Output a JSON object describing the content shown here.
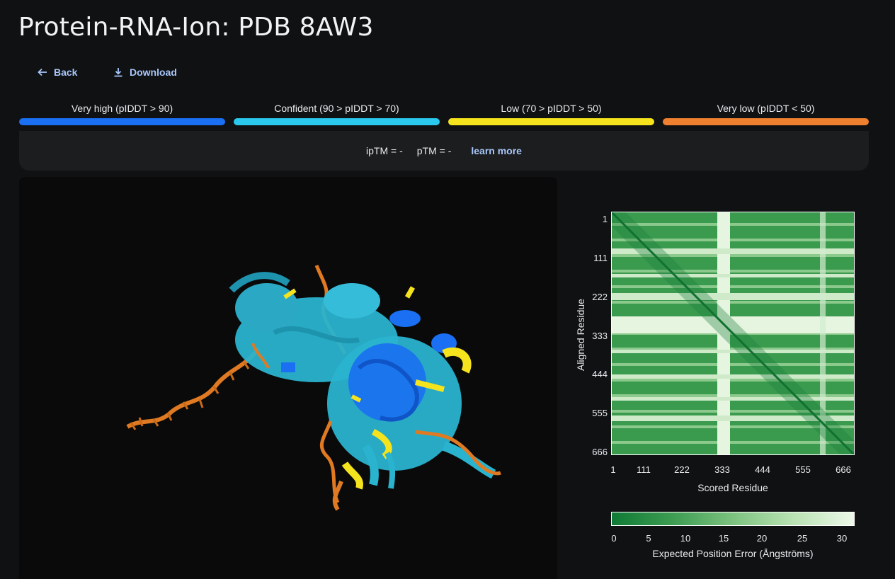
{
  "header": {
    "title": "Protein-RNA-Ion: PDB 8AW3"
  },
  "actions": {
    "back_label": "Back",
    "download_label": "Download"
  },
  "plddt_legend": [
    {
      "label": "Very high (pIDDT > 90)",
      "color": "#1a6ff2"
    },
    {
      "label": "Confident (90 > pIDDT > 70)",
      "color": "#29c8ec"
    },
    {
      "label": "Low (70 > pIDDT > 50)",
      "color": "#f5e41d"
    },
    {
      "label": "Very low (pIDDT < 50)",
      "color": "#ee8030"
    }
  ],
  "scores": {
    "iptm": "ipTM = -",
    "ptm": "pTM = -",
    "learn_more": "learn more"
  },
  "pae": {
    "y_ticks": [
      "1",
      "111",
      "222",
      "333",
      "444",
      "555",
      "666"
    ],
    "x_ticks": [
      "1",
      "111",
      "222",
      "333",
      "444",
      "555",
      "666"
    ],
    "y_label": "Aligned Residue",
    "x_label": "Scored Residue",
    "colorbar_ticks": [
      "0",
      "5",
      "10",
      "15",
      "20",
      "25",
      "30"
    ],
    "colorbar_label": "Expected Position Error (Ångströms)",
    "colors": {
      "low_error": "#0f7a35",
      "high_error": "#edf8e9"
    }
  }
}
